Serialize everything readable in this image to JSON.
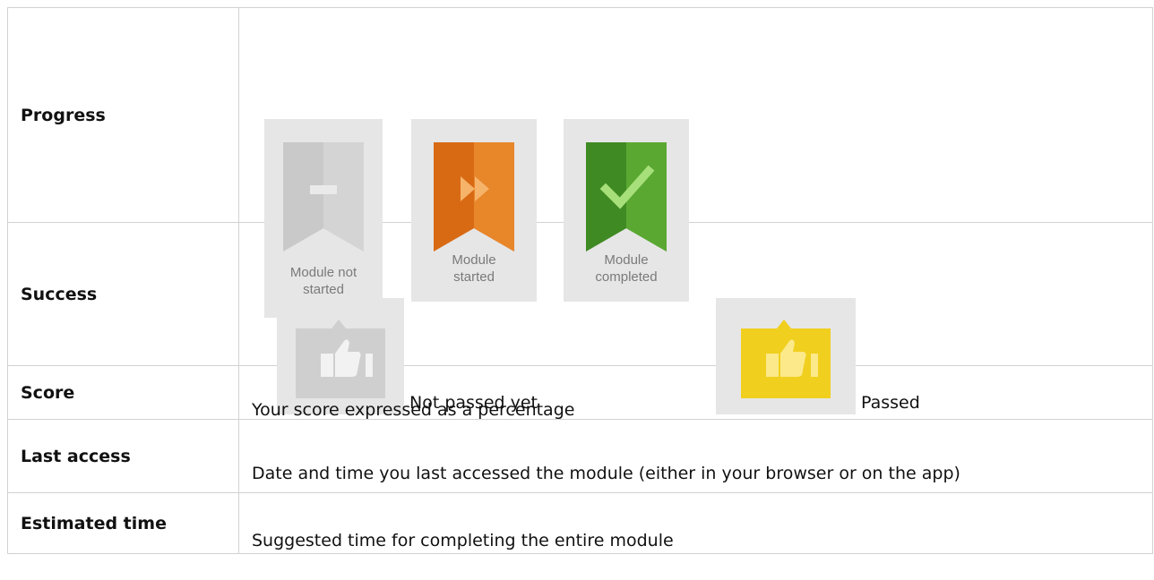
{
  "rows": {
    "progress": {
      "term": "Progress",
      "states": [
        {
          "label_line1": "Module not",
          "label_line2": "started",
          "icon": "bookmark-minus-icon",
          "color": "#c8c8c8"
        },
        {
          "label_line1": "Module",
          "label_line2": "started",
          "icon": "bookmark-fast-forward-icon",
          "color": "#e07a1f"
        },
        {
          "label_line1": "Module",
          "label_line2": "completed",
          "icon": "bookmark-check-icon",
          "color": "#4c9a2a"
        }
      ]
    },
    "success": {
      "term": "Success",
      "states": [
        {
          "label": "Not passed yet",
          "icon": "thumbs-up-gray-icon",
          "color": "#cccccc"
        },
        {
          "label": "Passed",
          "icon": "thumbs-up-yellow-icon",
          "color": "#f2d229"
        }
      ]
    },
    "score": {
      "term": "Score",
      "description": "Your score expressed as a percentage"
    },
    "last_access": {
      "term": "Last access",
      "description": "Date and time you last accessed the module (either in your browser or on the app)"
    },
    "estimated_time": {
      "term": "Estimated time",
      "description": "Suggested time for completing the entire module"
    }
  }
}
